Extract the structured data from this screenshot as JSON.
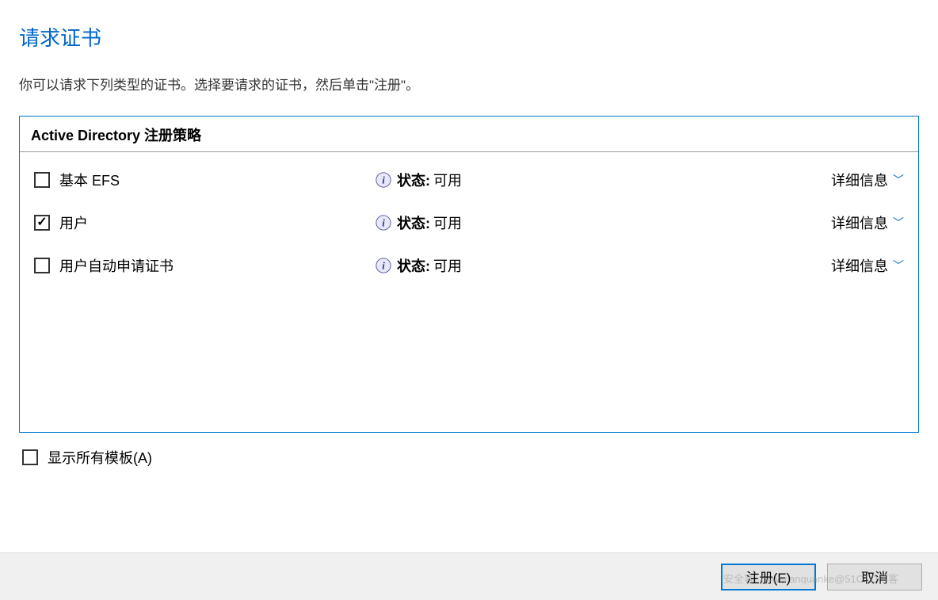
{
  "header": {
    "title": "请求证书",
    "description": "你可以请求下列类型的证书。选择要请求的证书，然后单击\"注册\"。"
  },
  "policy": {
    "header": "Active Directory 注册策略",
    "certs": [
      {
        "name": "基本 EFS",
        "checked": false,
        "status_label": "状态:",
        "status_value": "可用",
        "details": "详细信息"
      },
      {
        "name": "用户",
        "checked": true,
        "status_label": "状态:",
        "status_value": "可用",
        "details": "详细信息"
      },
      {
        "name": "用户自动申请证书",
        "checked": false,
        "status_label": "状态:",
        "status_value": "可用",
        "details": "详细信息"
      }
    ]
  },
  "show_all_label": "显示所有模板(A)",
  "buttons": {
    "enroll": "注册(E)",
    "cancel": "取消"
  },
  "watermark": "安全客（www.anquanke@51CTO博客"
}
